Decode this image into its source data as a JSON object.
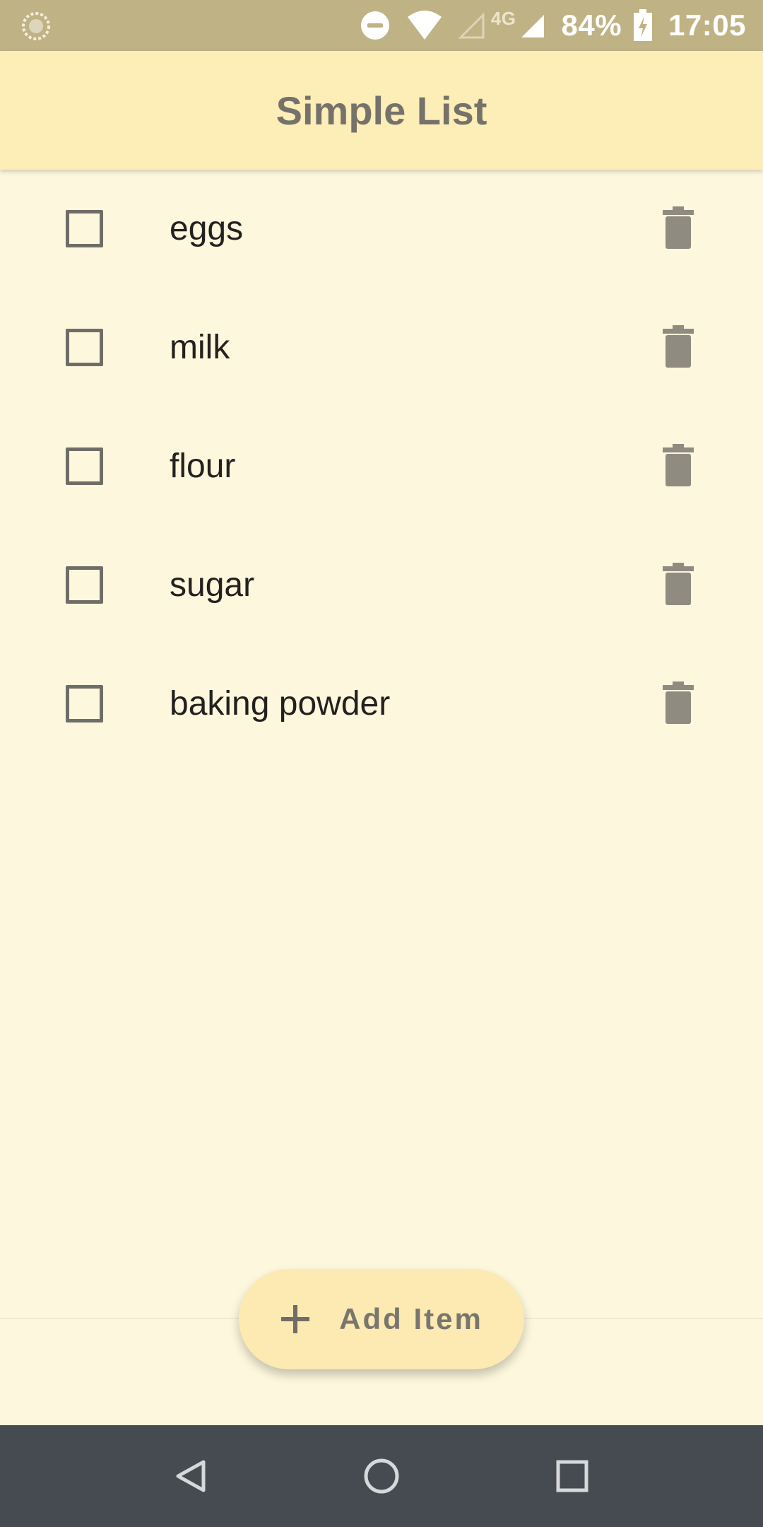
{
  "status_bar": {
    "battery": "84%",
    "time": "17:05",
    "network": "4G",
    "icons": [
      "loading-icon",
      "dnd-icon",
      "wifi-icon",
      "signal-empty-icon",
      "signal-icon",
      "battery-charging-icon"
    ]
  },
  "app_bar": {
    "title": "Simple List"
  },
  "list": {
    "items": [
      {
        "label": "eggs",
        "checked": false
      },
      {
        "label": "milk",
        "checked": false
      },
      {
        "label": "flour",
        "checked": false
      },
      {
        "label": "sugar",
        "checked": false
      },
      {
        "label": "baking powder",
        "checked": false
      }
    ],
    "delete_icon": "trash-icon"
  },
  "fab": {
    "label": "Add Item",
    "icon": "plus-icon"
  },
  "nav_bar": {
    "icons": [
      "back-icon",
      "home-icon",
      "recents-icon"
    ]
  },
  "colors": {
    "status_bar": "#bfb284",
    "app_bar": "#fdedb7",
    "background": "#fdf7dd",
    "fab": "#fdeab2",
    "nav_bar": "#454b50",
    "icon_gray": "#8f8b80"
  }
}
